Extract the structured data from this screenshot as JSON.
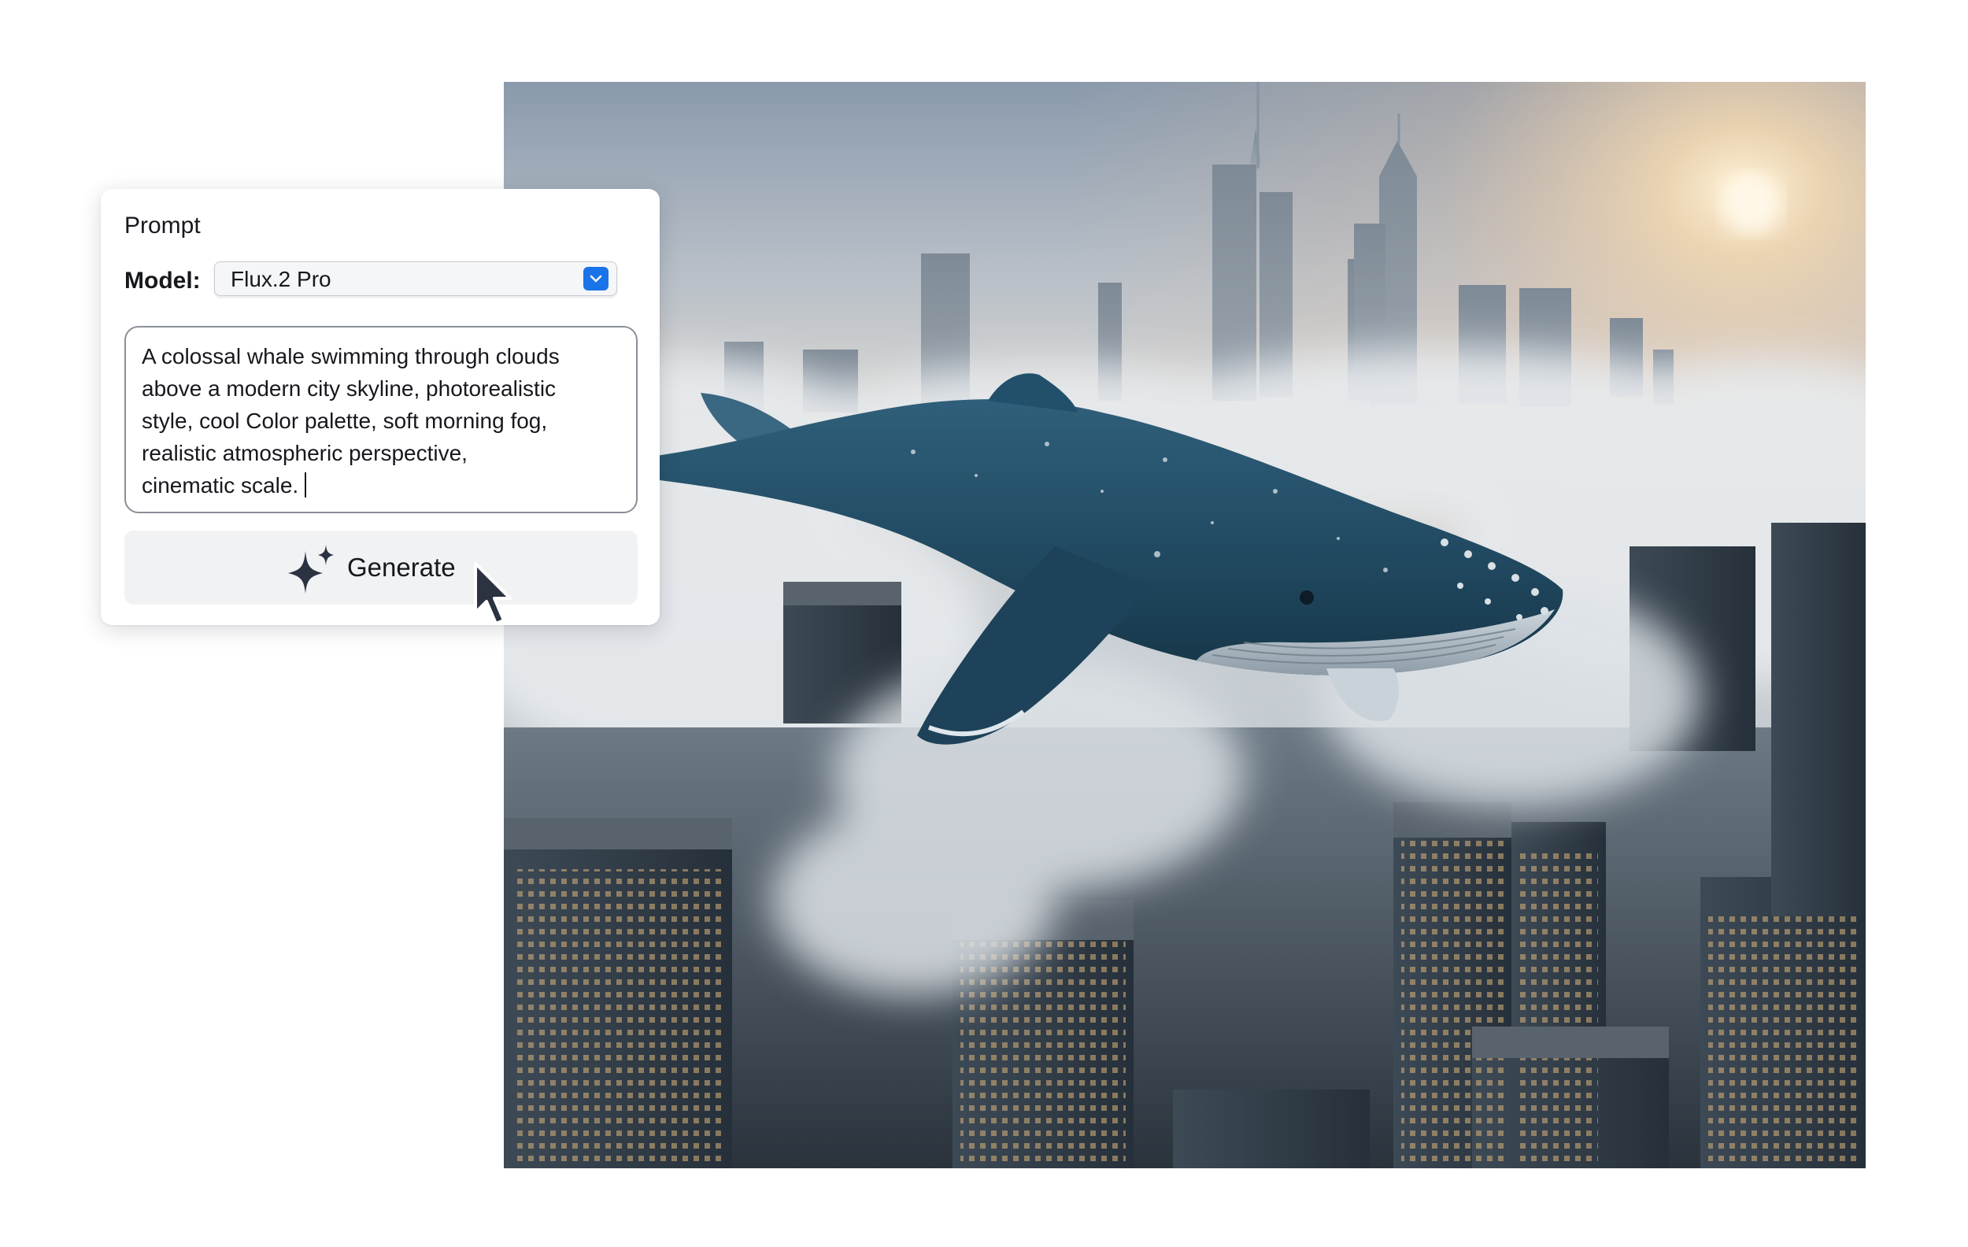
{
  "prompt_panel": {
    "title": "Prompt",
    "model_label": "Model:",
    "model_value": "Flux.2 Pro",
    "prompt_text": "A colossal whale swimming through clouds\nabove a modern city skyline, photorealistic\nstyle, cool Color palette, soft morning fog,\nrealistic atmospheric perspective,\ncinematic scale.",
    "generate_label": "Generate",
    "select_accent": "#1a73e8"
  },
  "generated_image": {
    "icon": "whale-over-city-photo"
  },
  "icons": {
    "sparkle": "sparkle-icon",
    "chevron": "chevron-down-icon",
    "cursor": "mouse-pointer-icon"
  }
}
